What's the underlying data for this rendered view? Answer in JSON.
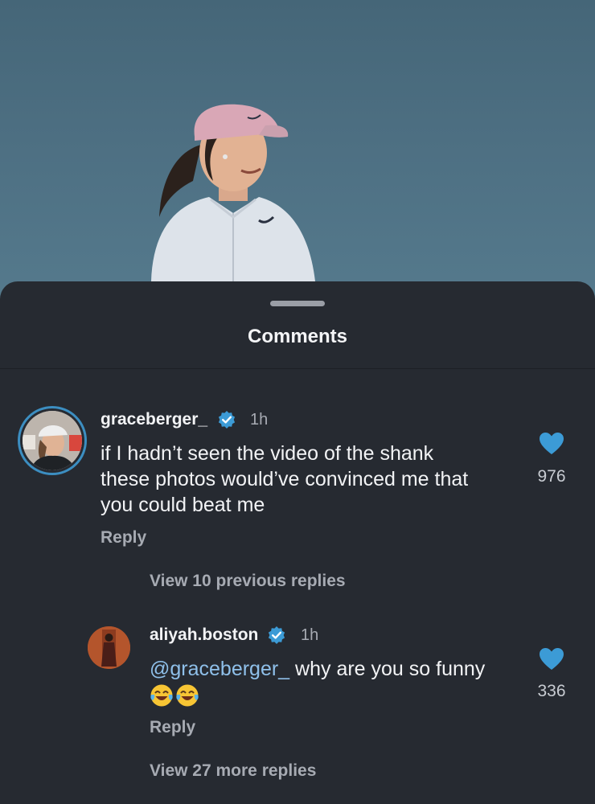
{
  "header": {
    "title": "Comments"
  },
  "comments": [
    {
      "username": "graceberger_",
      "verified": true,
      "time": "1h",
      "text_lines": [
        "if I hadn’t seen the video of the shank",
        "these photos would’ve convinced me that",
        "you could beat me"
      ],
      "likes": "976",
      "reply_label": "Reply"
    },
    {
      "username": "aliyah.boston",
      "verified": true,
      "time": "1h",
      "mention": "@graceberger_",
      "text": " why are you so funny",
      "emojis": [
        "face-with-tears-of-joy",
        "face-with-tears-of-joy"
      ],
      "likes": "336",
      "reply_label": "Reply"
    }
  ],
  "view_previous_label": "View 10 previous replies",
  "view_more_label": "View 27 more replies",
  "colors": {
    "sheet_bg": "#262a31",
    "accent_blue": "#3c9bd6",
    "mention": "#8fc0ea",
    "muted_text": "#a7abb3"
  }
}
